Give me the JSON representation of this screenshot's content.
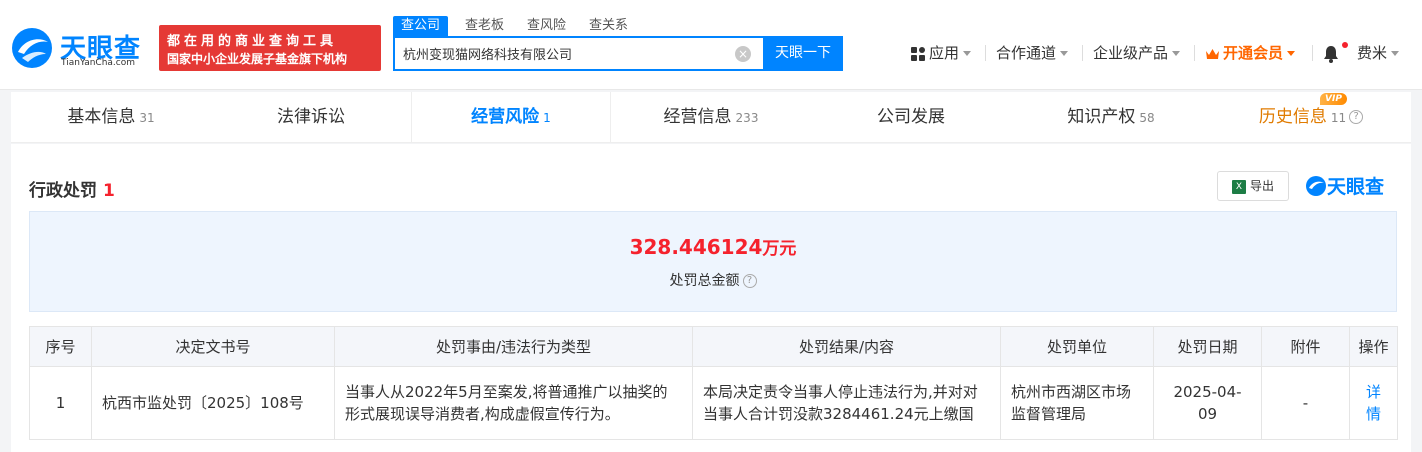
{
  "header": {
    "logo_text": "天眼查",
    "logo_sub": "TianYanCha.com",
    "promo_line1": "都在用的商业查询工具",
    "promo_line2": "国家中小企业发展子基金旗下机构",
    "search_tabs": [
      "查公司",
      "查老板",
      "查风险",
      "查关系"
    ],
    "search_value": "杭州变现猫网络科技有限公司",
    "search_button": "天眼一下",
    "nav": {
      "apps": "应用",
      "channels": "合作通道",
      "enterprise": "企业级产品",
      "vip": "开通会员",
      "user": "费米"
    },
    "vip_icon": "crown-icon",
    "bell_icon": "bell-icon"
  },
  "tabs": [
    {
      "label": "基本信息",
      "count": "31"
    },
    {
      "label": "法律诉讼",
      "count": ""
    },
    {
      "label": "经营风险",
      "count": "1"
    },
    {
      "label": "经营信息",
      "count": "233"
    },
    {
      "label": "公司发展",
      "count": ""
    },
    {
      "label": "知识产权",
      "count": "58"
    },
    {
      "label": "历史信息",
      "count": "11"
    }
  ],
  "vip_badge": "VIP",
  "section": {
    "title": "行政处罚",
    "count": "1",
    "export_label": "导出",
    "brand": "天眼查"
  },
  "summary": {
    "amount": "328.446124",
    "unit": "万元",
    "label": "处罚总金额"
  },
  "table": {
    "headers": [
      "序号",
      "决定文书号",
      "处罚事由/违法行为类型",
      "处罚结果/内容",
      "处罚单位",
      "处罚日期",
      "附件",
      "操作"
    ],
    "rows": [
      {
        "index": "1",
        "doc_no": "杭西市监处罚〔2025〕108号",
        "reason": "当事人从2022年5月至案发,将普通推广以抽奖的形式展现误导消费者,构成虚假宣传行为。",
        "result": "本局决定责令当事人停止违法行为,并对对当事人合计罚没款3284461.24元上缴国",
        "authority": "杭州市西湖区市场监督管理局",
        "date": "2025-04-09",
        "attachment": "-",
        "action": "详情"
      }
    ]
  },
  "colors": {
    "brand_blue": "#0084ff",
    "alert_red": "#f5222d",
    "vip_orange": "#ff6600"
  }
}
